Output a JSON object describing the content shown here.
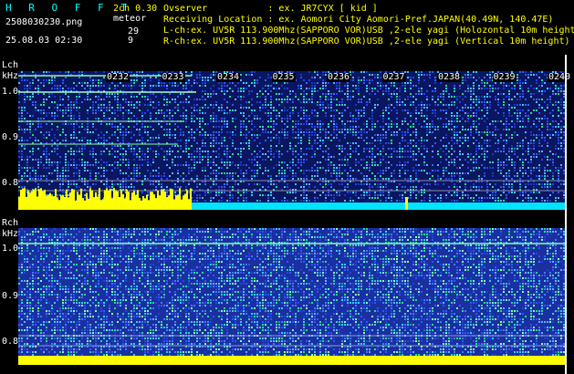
{
  "header": {
    "brand": "H R O F F T",
    "mode": "2ch 0.30",
    "filename": "2508030230.png",
    "meteor_label": "meteor",
    "datetime": "25.08.03 02:30",
    "count_l": "29",
    "count_r": "9",
    "observer_line": "Ovserver           : ex. JR7CYX [ kid ]",
    "location_line": "Receiving Location : ex. Aomori City Aomori-Pref.JAPAN(40.49N, 140.47E)",
    "lch_line": "L-ch:ex. UV5R 113.900Mhz(SAPPORO VOR)USB ,2-ele yagi (Holozontal 10m height)",
    "rch_line": "R-ch:ex. UV5R 113.900Mhz(SAPPORO VOR)USB ,2-ele yagi (Vertical 10m height)"
  },
  "lch": {
    "channel": "Lch",
    "unit": "kHz",
    "y_ticks": [
      "1.0",
      "0.9",
      "0.8"
    ]
  },
  "rch": {
    "channel": "Rch",
    "unit": "kHz",
    "y_ticks": [
      "1.0",
      "0.9",
      "0.8"
    ]
  },
  "time_ticks": [
    "0232",
    "0233",
    "0234",
    "0235",
    "0236",
    "0237",
    "0238",
    "0239",
    "0240"
  ],
  "colors": {
    "background": "#000000",
    "spectrum_base": "#1a2fa0",
    "signal": "#ffff00",
    "accent": "#00ffff"
  }
}
